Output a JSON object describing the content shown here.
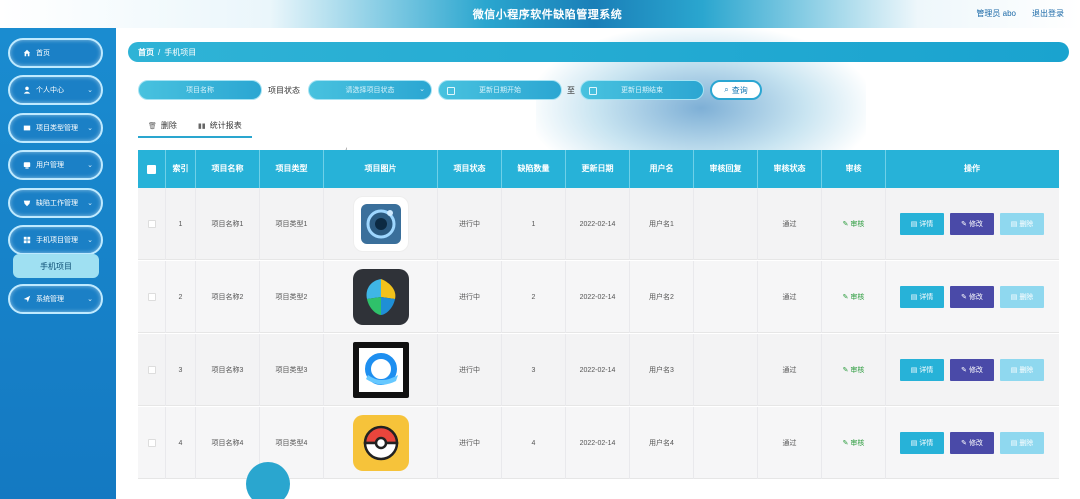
{
  "header": {
    "title": "微信小程序软件缺陷管理系统",
    "user_label": "管理员 abo",
    "logout_label": "退出登录"
  },
  "sidebar": {
    "items": [
      {
        "label": "首页",
        "icon": "home-icon",
        "has_chevron": false
      },
      {
        "label": "个人中心",
        "icon": "user-icon",
        "has_chevron": true
      },
      {
        "label": "项目类型管理",
        "icon": "folder-icon",
        "has_chevron": true
      },
      {
        "label": "用户管理",
        "icon": "users-icon",
        "has_chevron": true
      },
      {
        "label": "缺陷工作管理",
        "icon": "bug-icon",
        "has_chevron": true
      },
      {
        "label": "手机项目管理",
        "icon": "grid-icon",
        "has_chevron": true
      },
      {
        "label": "系统管理",
        "icon": "send-icon",
        "has_chevron": true
      }
    ],
    "active_sub_item": "手机项目"
  },
  "breadcrumb": {
    "home": "首页",
    "separator": "/",
    "current": "手机项目"
  },
  "filters": {
    "name_placeholder": "项目名称",
    "status_label": "项目状态",
    "status_placeholder": "请选择项目状态",
    "date_start_placeholder": "更新日期开始",
    "date_to": "至",
    "date_end_placeholder": "更新日期结束",
    "search_label": "查询"
  },
  "tabs": {
    "delete_label": "删除",
    "stats_label": "统计报表"
  },
  "table": {
    "headers": [
      "索引",
      "项目名称",
      "项目类型",
      "项目图片",
      "项目状态",
      "缺陷数量",
      "更新日期",
      "用户名",
      "审核回复",
      "审核状态",
      "审核",
      "操作"
    ],
    "audit_action": "审核",
    "op_detail": "详情",
    "op_edit": "修改",
    "op_delete": "删除",
    "rows": [
      {
        "index": "1",
        "name": "项目名称1",
        "type": "项目类型1",
        "status": "进行中",
        "defects": "1",
        "date": "2022-02-14",
        "user": "用户名1",
        "reply": "",
        "audit_status": "通过",
        "icon": "camera-lens-app-icon"
      },
      {
        "index": "2",
        "name": "项目名称2",
        "type": "项目类型2",
        "status": "进行中",
        "defects": "2",
        "date": "2022-02-14",
        "user": "用户名2",
        "reply": "",
        "audit_status": "通过",
        "icon": "colorful-leaves-app-icon"
      },
      {
        "index": "3",
        "name": "项目名称3",
        "type": "项目类型3",
        "status": "进行中",
        "defects": "3",
        "date": "2022-02-14",
        "user": "用户名3",
        "reply": "",
        "audit_status": "通过",
        "icon": "browser-q-app-icon"
      },
      {
        "index": "4",
        "name": "项目名称4",
        "type": "项目类型4",
        "status": "进行中",
        "defects": "4",
        "date": "2022-02-14",
        "user": "用户名4",
        "reply": "",
        "audit_status": "通过",
        "icon": "pokeball-app-icon"
      }
    ]
  }
}
